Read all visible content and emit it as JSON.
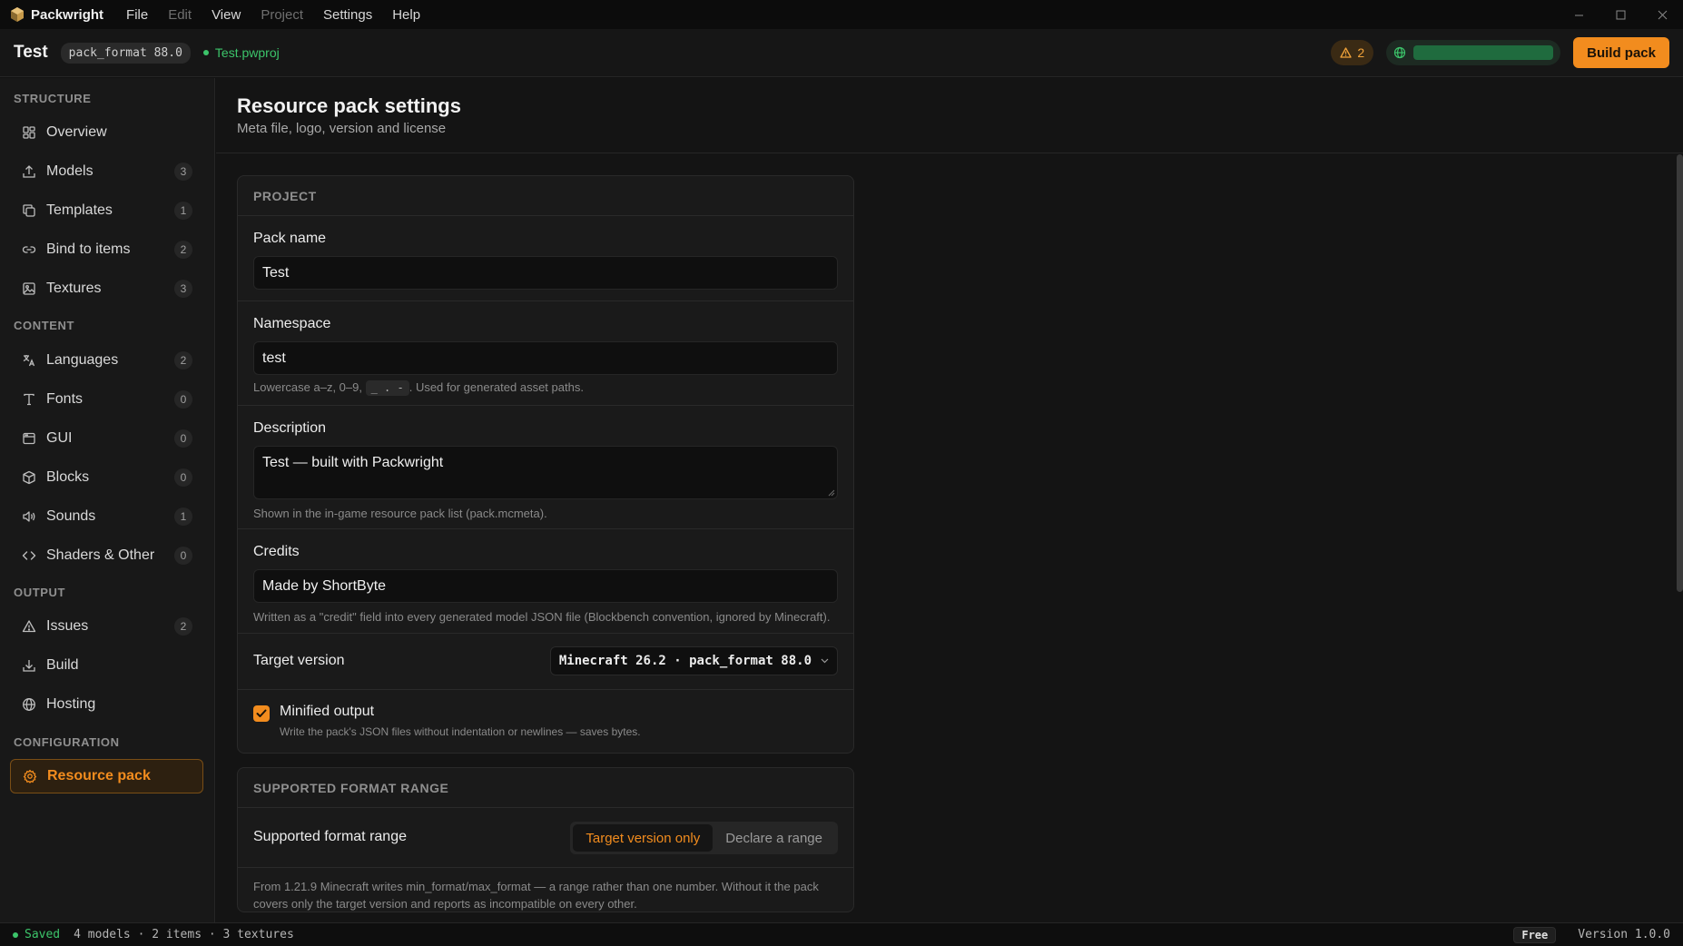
{
  "titlebar": {
    "app_name": "Packwright",
    "menu": [
      "File",
      "Edit",
      "View",
      "Project",
      "Settings",
      "Help"
    ]
  },
  "header": {
    "project_name": "Test",
    "format_chip": "pack_format 88.0",
    "file_name": "Test.pwproj",
    "warning_count": "2",
    "build_label": "Build pack"
  },
  "sidebar": {
    "sections": {
      "structure": "STRUCTURE",
      "content": "CONTENT",
      "output": "OUTPUT",
      "configuration": "CONFIGURATION"
    },
    "items": [
      {
        "label": "Overview",
        "count": null,
        "icon": "grid-icon"
      },
      {
        "label": "Models",
        "count": "3",
        "icon": "upload-box-icon"
      },
      {
        "label": "Templates",
        "count": "1",
        "icon": "copy-icon"
      },
      {
        "label": "Bind to items",
        "count": "2",
        "icon": "link-icon"
      },
      {
        "label": "Textures",
        "count": "3",
        "icon": "image-icon"
      },
      {
        "label": "Languages",
        "count": "2",
        "icon": "translate-icon"
      },
      {
        "label": "Fonts",
        "count": "0",
        "icon": "type-icon"
      },
      {
        "label": "GUI",
        "count": "0",
        "icon": "window-icon"
      },
      {
        "label": "Blocks",
        "count": "0",
        "icon": "cube-icon"
      },
      {
        "label": "Sounds",
        "count": "1",
        "icon": "speaker-icon"
      },
      {
        "label": "Shaders & Other",
        "count": "0",
        "icon": "code-icon"
      },
      {
        "label": "Issues",
        "count": "2",
        "icon": "warning-icon"
      },
      {
        "label": "Build",
        "count": null,
        "icon": "download-icon"
      },
      {
        "label": "Hosting",
        "count": null,
        "icon": "globe-icon"
      },
      {
        "label": "Resource pack",
        "count": null,
        "icon": "gear-icon"
      }
    ]
  },
  "page": {
    "title": "Resource pack settings",
    "subtitle": "Meta file, logo, version and license"
  },
  "project_card": {
    "header": "PROJECT",
    "pack_name_label": "Pack name",
    "pack_name_value": "Test",
    "namespace_label": "Namespace",
    "namespace_value": "test",
    "namespace_hint_pre": "Lowercase a–z, 0–9,",
    "namespace_hint_chars": "_ . -",
    "namespace_hint_post": ". Used for generated asset paths.",
    "description_label": "Description",
    "description_value": "Test — built with Packwright",
    "description_hint": "Shown in the in-game resource pack list (pack.mcmeta).",
    "credits_label": "Credits",
    "credits_value": "Made by ShortByte",
    "credits_hint": "Written as a \"credit\" field into every generated model JSON file (Blockbench convention, ignored by Minecraft).",
    "target_version_label": "Target version",
    "target_version_value": "Minecraft 26.2 · pack_format 88.0",
    "minified_label": "Minified output",
    "minified_hint": "Write the pack's JSON files without indentation or newlines — saves bytes."
  },
  "range_card": {
    "header": "SUPPORTED FORMAT RANGE",
    "label": "Supported format range",
    "options": [
      "Target version only",
      "Declare a range"
    ],
    "note": "From 1.21.9 Minecraft writes min_format/max_format — a range rather than one number. Without it the pack covers only the target version and reports as incompatible on every other."
  },
  "statusbar": {
    "saved": "Saved",
    "summary": "4 models · 2 items · 3 textures",
    "plan": "Free",
    "version": "Version 1.0.0"
  },
  "colors": {
    "accent": "#f28c1e",
    "success": "#3cc46a",
    "warning": "#f2a33a"
  }
}
